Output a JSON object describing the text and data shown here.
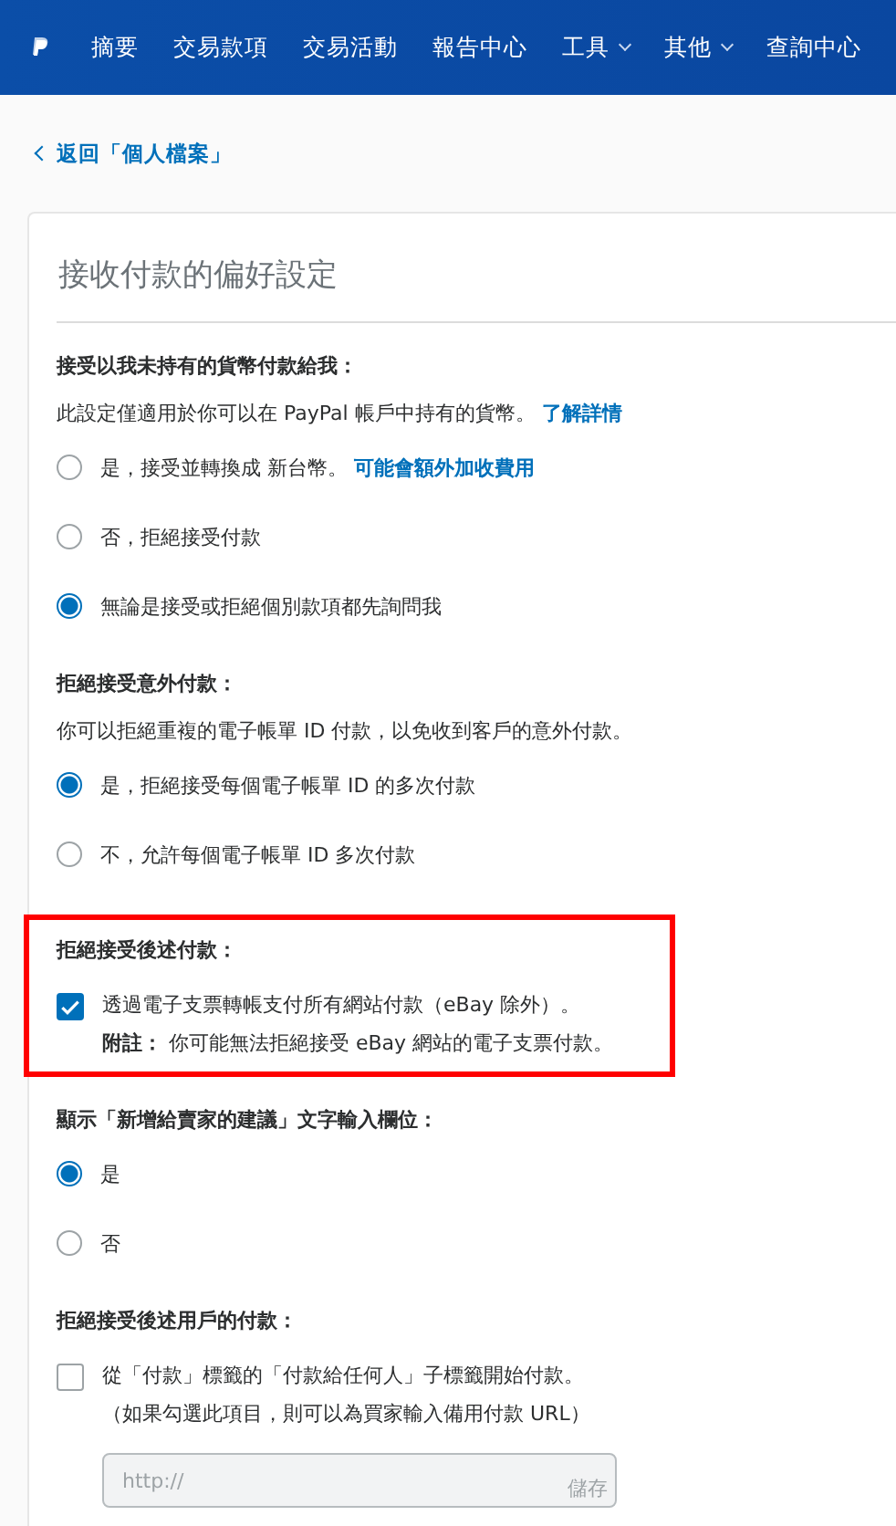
{
  "nav": {
    "items": [
      {
        "label": "摘要",
        "dropdown": false
      },
      {
        "label": "交易款項",
        "dropdown": false
      },
      {
        "label": "交易活動",
        "dropdown": false
      },
      {
        "label": "報告中心",
        "dropdown": false
      },
      {
        "label": "工具",
        "dropdown": true
      },
      {
        "label": "其他",
        "dropdown": true
      },
      {
        "label": "查詢中心",
        "dropdown": false
      }
    ]
  },
  "back_link": "返回「個人檔案」",
  "card": {
    "title": "接收付款的偏好設定",
    "sections": [
      {
        "heading": "接受以我未持有的貨幣付款給我：",
        "highlighted": false,
        "description": "此設定僅適用於你可以在 PayPal 帳戶中持有的貨幣。",
        "description_link": "了解詳情",
        "options": [
          {
            "kind": "radio",
            "label": "是，接受並轉換成 新台幣。",
            "link": "可能會額外加收費用",
            "selected": false
          },
          {
            "kind": "radio",
            "label": "否，拒絕接受付款",
            "selected": false
          },
          {
            "kind": "radio",
            "label": "無論是接受或拒絕個別款項都先詢問我",
            "selected": true
          }
        ]
      },
      {
        "heading": "拒絕接受意外付款：",
        "highlighted": false,
        "description": "你可以拒絕重複的電子帳單 ID 付款，以免收到客戶的意外付款。",
        "options": [
          {
            "kind": "radio",
            "label": "是，拒絕接受每個電子帳單 ID 的多次付款",
            "selected": true
          },
          {
            "kind": "radio",
            "label": "不，允許每個電子帳單 ID 多次付款",
            "selected": false
          }
        ]
      },
      {
        "heading": "拒絕接受後述付款：",
        "highlighted": true,
        "options": [
          {
            "kind": "checkbox",
            "label": "透過電子支票轉帳支付所有網站付款（eBay 除外）。",
            "note": "**附註：** 你可能無法拒絕接受 eBay 網站的電子支票付款。",
            "checked": true
          }
        ]
      },
      {
        "heading": "顯示「新增給賣家的建議」文字輸入欄位：",
        "highlighted": false,
        "options": [
          {
            "kind": "radio",
            "label": "是",
            "selected": true
          },
          {
            "kind": "radio",
            "label": "否",
            "selected": false
          }
        ]
      },
      {
        "heading": "拒絕接受後述用戶的付款：",
        "highlighted": false,
        "options": [
          {
            "kind": "checkbox",
            "label": "從「付款」標籤的「付款給任何人」子標籤開始付款。",
            "note": "（如果勾選此項目，則可以為買家輸入備用付款 URL）",
            "checked": false,
            "input": {
              "placeholder": "http://",
              "button": "儲存"
            }
          }
        ]
      }
    ]
  }
}
